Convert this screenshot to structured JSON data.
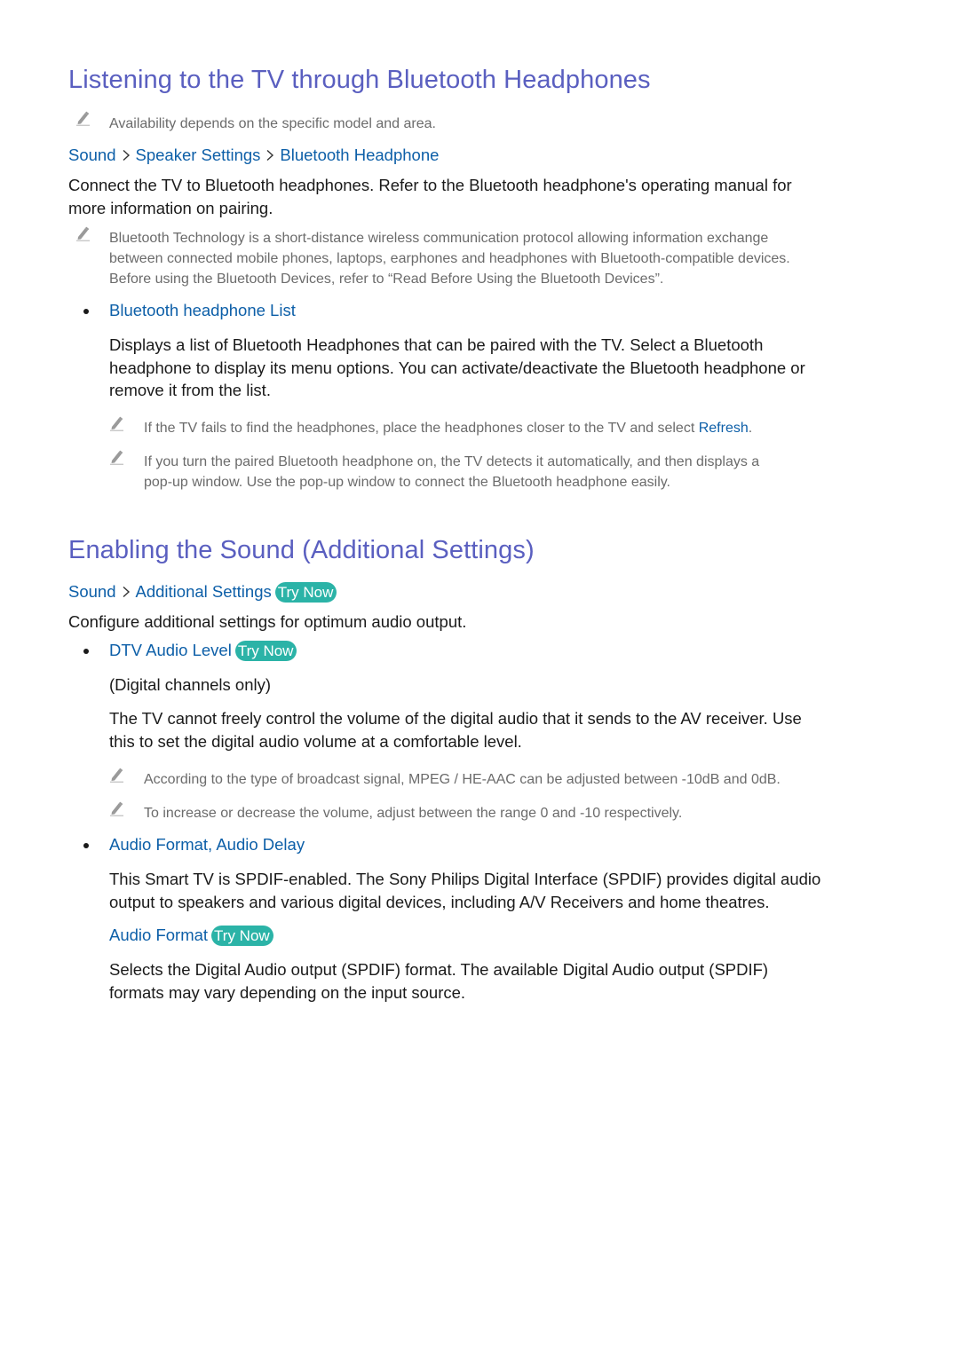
{
  "section1": {
    "title": "Listening to the TV through Bluetooth Headphones",
    "availability_note": "Availability depends on the specific model and area.",
    "breadcrumb": [
      "Sound",
      "Speaker Settings",
      "Bluetooth Headphone"
    ],
    "intro_line1": "Connect the TV to Bluetooth headphones. Refer to the Bluetooth headphone's operating manual for",
    "intro_line2": "more information on pairing.",
    "tech_note_line1": "Bluetooth Technology is a short-distance wireless communication protocol allowing information exchange",
    "tech_note_line2": "between connected mobile phones, laptops, earphones and headphones with Bluetooth-compatible devices.",
    "tech_note_line3": "Before using the Bluetooth Devices, refer to “Read Before Using the Bluetooth Devices”.",
    "bullet_list": {
      "heading": "Bluetooth headphone List",
      "desc_line1": "Displays a list of Bluetooth Headphones that can be paired with the TV. Select a Bluetooth",
      "desc_line2": "headphone to display its menu options. You can activate/deactivate the Bluetooth headphone or",
      "desc_line3": "remove it from the list.",
      "note1_prefix": "If the TV fails to find the headphones, place the headphones closer to the TV and select ",
      "note1_link": "Refresh",
      "note1_suffix": ".",
      "note2_line1": "If you turn the paired Bluetooth headphone on, the TV detects it automatically, and then displays a",
      "note2_line2": "pop-up window. Use the pop-up window to connect the Bluetooth headphone easily."
    }
  },
  "section2": {
    "title": "Enabling the Sound (Additional Settings)",
    "breadcrumb": [
      "Sound",
      "Additional Settings"
    ],
    "try_now_label": "Try Now",
    "intro": "Configure additional settings for optimum audio output.",
    "dtv": {
      "heading": "DTV Audio Level",
      "try_now_label": "Try Now",
      "qualifier": "(Digital channels only)",
      "desc_line1": "The TV cannot freely control the volume of the digital audio that it sends to the AV receiver. Use",
      "desc_line2": "this to set the digital audio volume at a comfortable level.",
      "note1": "According to the type of broadcast signal, MPEG / HE-AAC can be adjusted between -10dB and 0dB.",
      "note2": "To increase or decrease the volume, adjust between the range 0 and -10 respectively."
    },
    "audio_format_delay": {
      "heading_part1": "Audio Format",
      "heading_sep": ", ",
      "heading_part2": "Audio Delay",
      "desc_line1": "This Smart TV is SPDIF-enabled. The Sony Philips Digital Interface (SPDIF) provides digital audio",
      "desc_line2": "output to speakers and various digital devices, including A/V Receivers and home theatres.",
      "sub_heading": "Audio Format",
      "sub_try_now_label": "Try Now",
      "sub_desc_line1": "Selects the Digital Audio output (SPDIF) format. The available Digital Audio output (SPDIF)",
      "sub_desc_line2": "formats may vary depending on the input source."
    }
  },
  "colors": {
    "heading": "#5a5fc0",
    "link": "#0d5fa8",
    "note_text": "#6b6b6b",
    "try_now_bg": "#2bb3a7"
  }
}
